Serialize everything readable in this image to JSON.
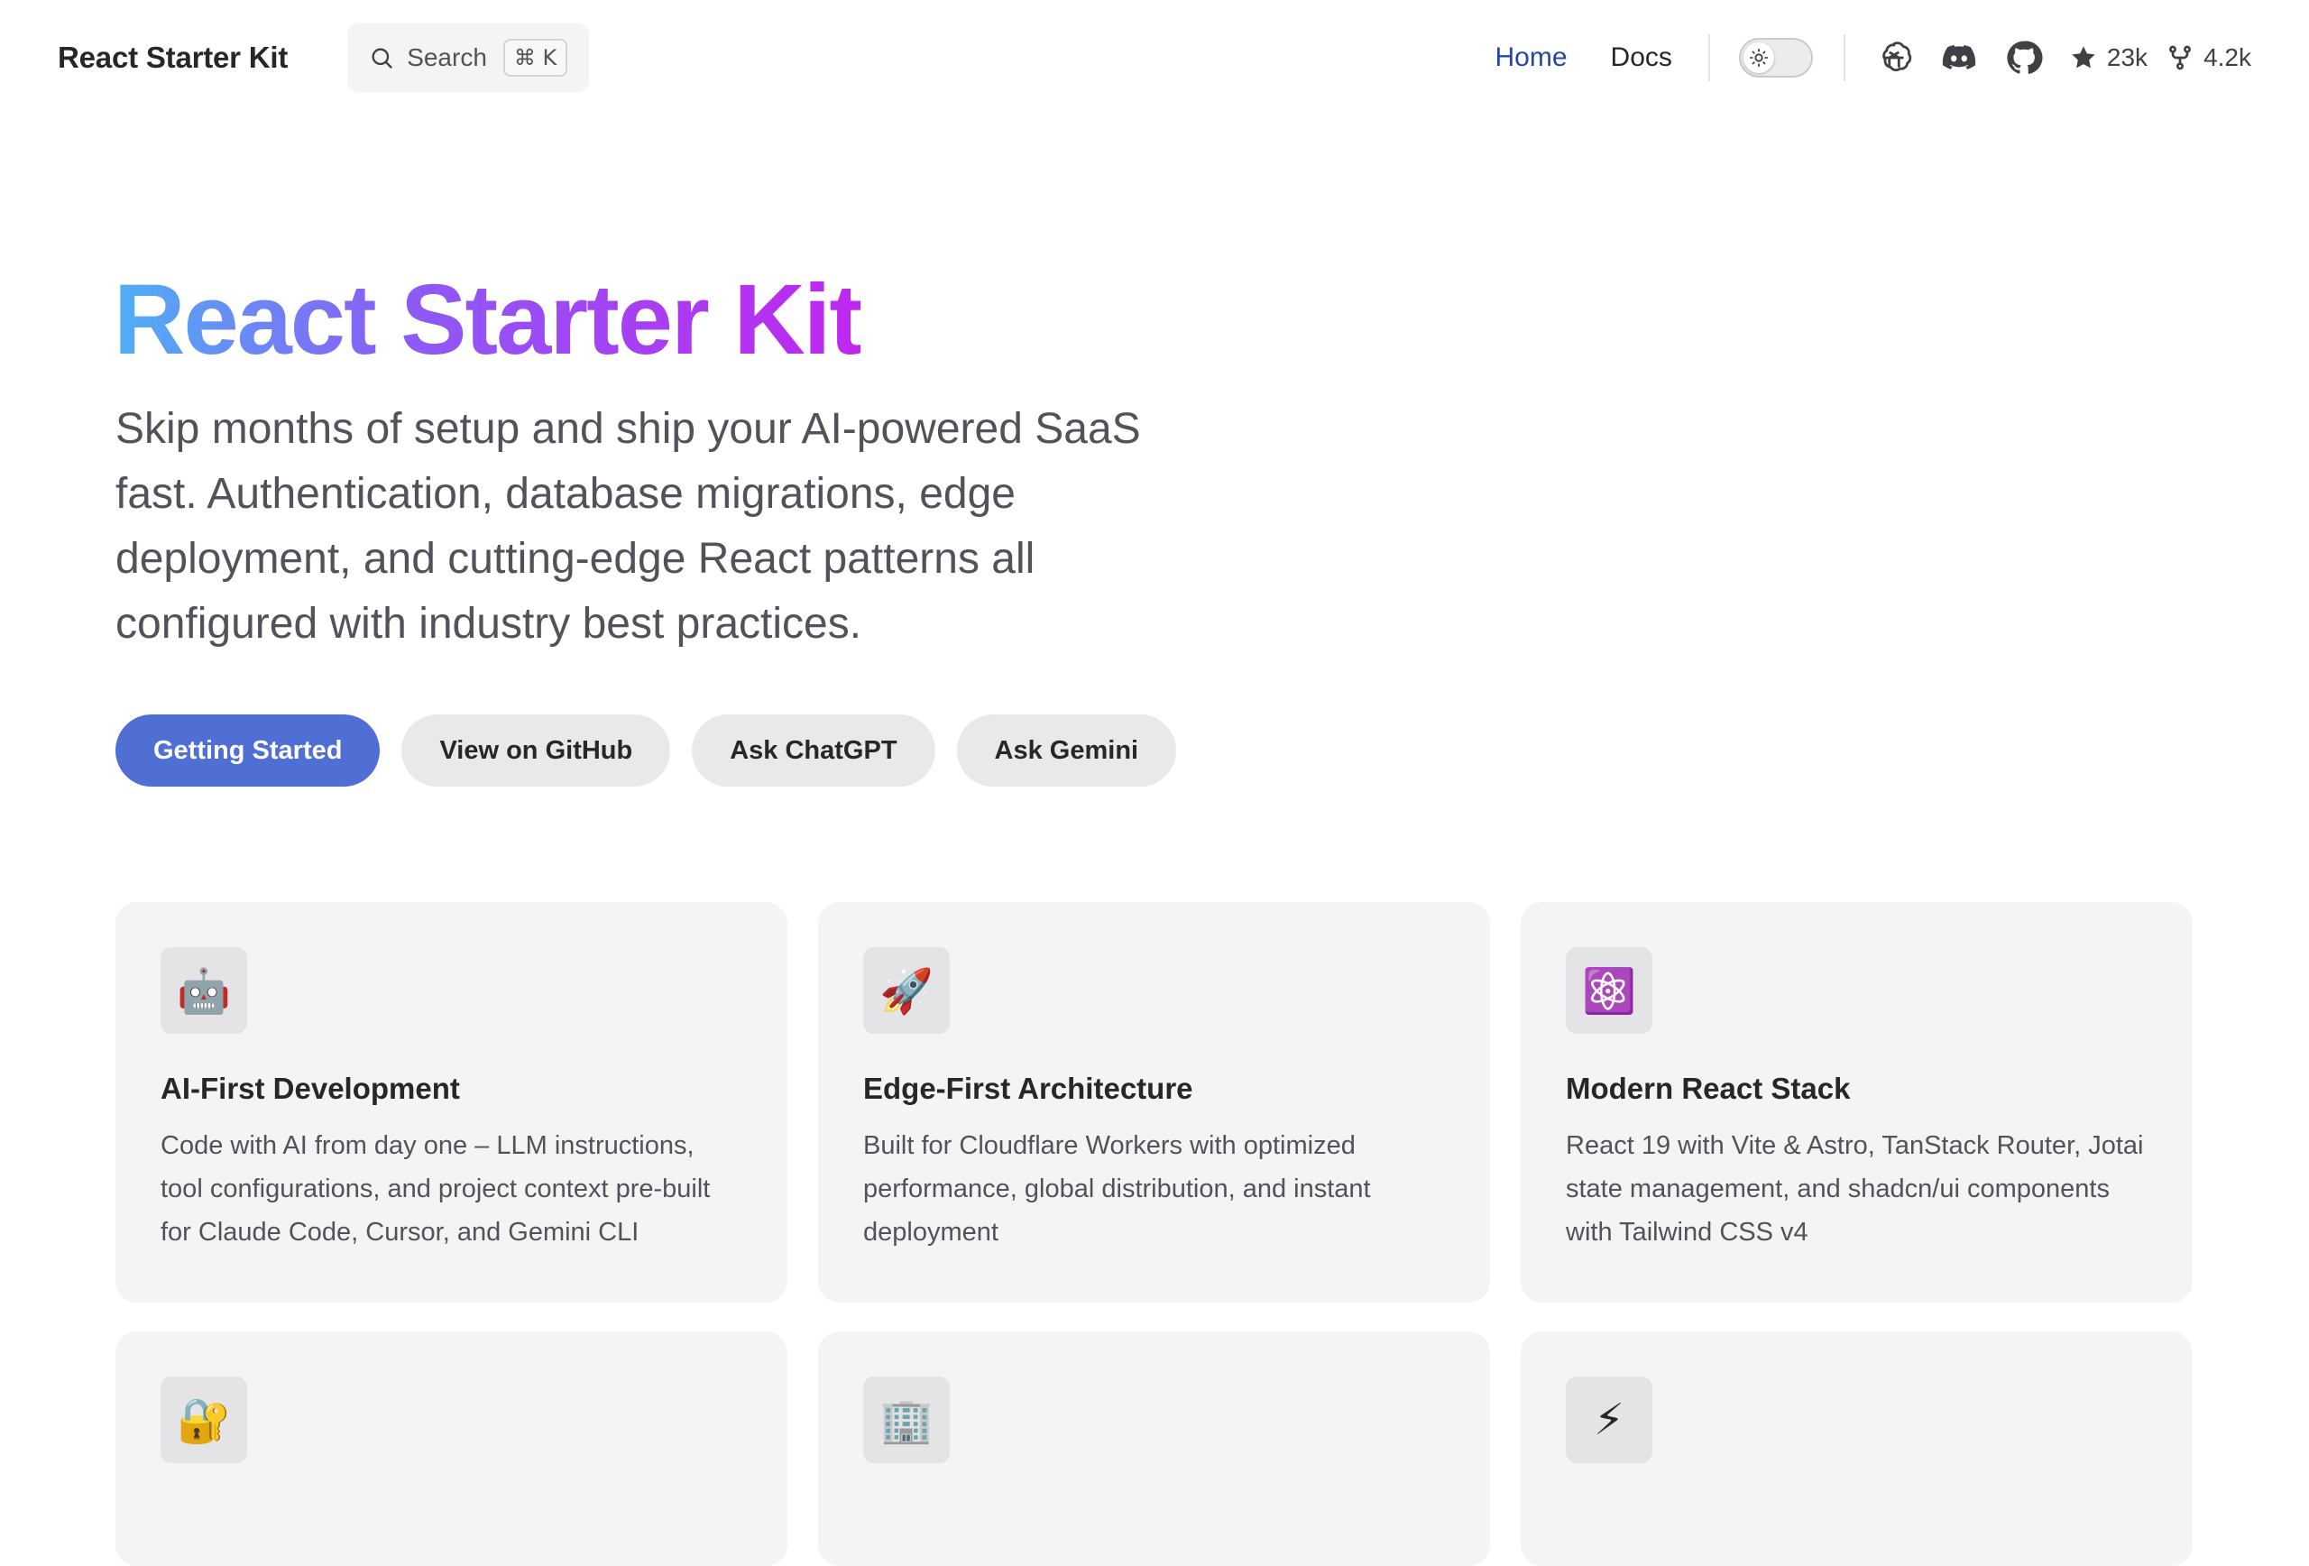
{
  "header": {
    "brand": "React Starter Kit",
    "search": {
      "label": "Search",
      "shortcut": "⌘ K"
    },
    "nav": [
      {
        "label": "Home",
        "active": true
      },
      {
        "label": "Docs",
        "active": false
      }
    ],
    "theme_toggle": {
      "state": "light",
      "icon": "sun-icon"
    },
    "social_icons": [
      "chatgpt-icon",
      "discord-icon",
      "github-icon"
    ],
    "stats": {
      "stars": {
        "icon": "star-icon",
        "value": "23k"
      },
      "forks": {
        "icon": "fork-icon",
        "value": "4.2k"
      }
    }
  },
  "hero": {
    "title": "React Starter Kit",
    "subtitle": "Skip months of setup and ship your AI-powered SaaS fast. Authentication, database migrations, edge deployment, and cutting-edge React patterns all configured with industry best practices.",
    "gradient": [
      "#4fb0f5",
      "#8b5cf6",
      "#c026f0"
    ],
    "buttons": [
      {
        "label": "Getting Started",
        "variant": "primary"
      },
      {
        "label": "View on GitHub",
        "variant": "secondary"
      },
      {
        "label": "Ask ChatGPT",
        "variant": "secondary"
      },
      {
        "label": "Ask Gemini",
        "variant": "secondary"
      }
    ]
  },
  "features": [
    {
      "icon": "🤖",
      "icon_name": "robot-icon",
      "title": "AI-First Development",
      "description": "Code with AI from day one – LLM instructions, tool configurations, and project context pre-built for Claude Code, Cursor, and Gemini CLI"
    },
    {
      "icon": "🚀",
      "icon_name": "rocket-icon",
      "title": "Edge-First Architecture",
      "description": "Built for Cloudflare Workers with optimized performance, global distribution, and instant deployment"
    },
    {
      "icon": "⚛️",
      "icon_name": "atom-icon",
      "title": "Modern React Stack",
      "description": "React 19 with Vite & Astro, TanStack Router, Jotai state management, and shadcn/ui components with Tailwind CSS v4"
    },
    {
      "icon": "🔐",
      "icon_name": "lock-icon",
      "title": "",
      "description": ""
    },
    {
      "icon": "🏢",
      "icon_name": "building-icon",
      "title": "",
      "description": ""
    },
    {
      "icon": "⚡",
      "icon_name": "lightning-icon",
      "title": "",
      "description": ""
    }
  ],
  "colors": {
    "primary_button": "#4f6fd5",
    "active_nav": "#2747a5",
    "card_bg": "#f4f4f5"
  }
}
